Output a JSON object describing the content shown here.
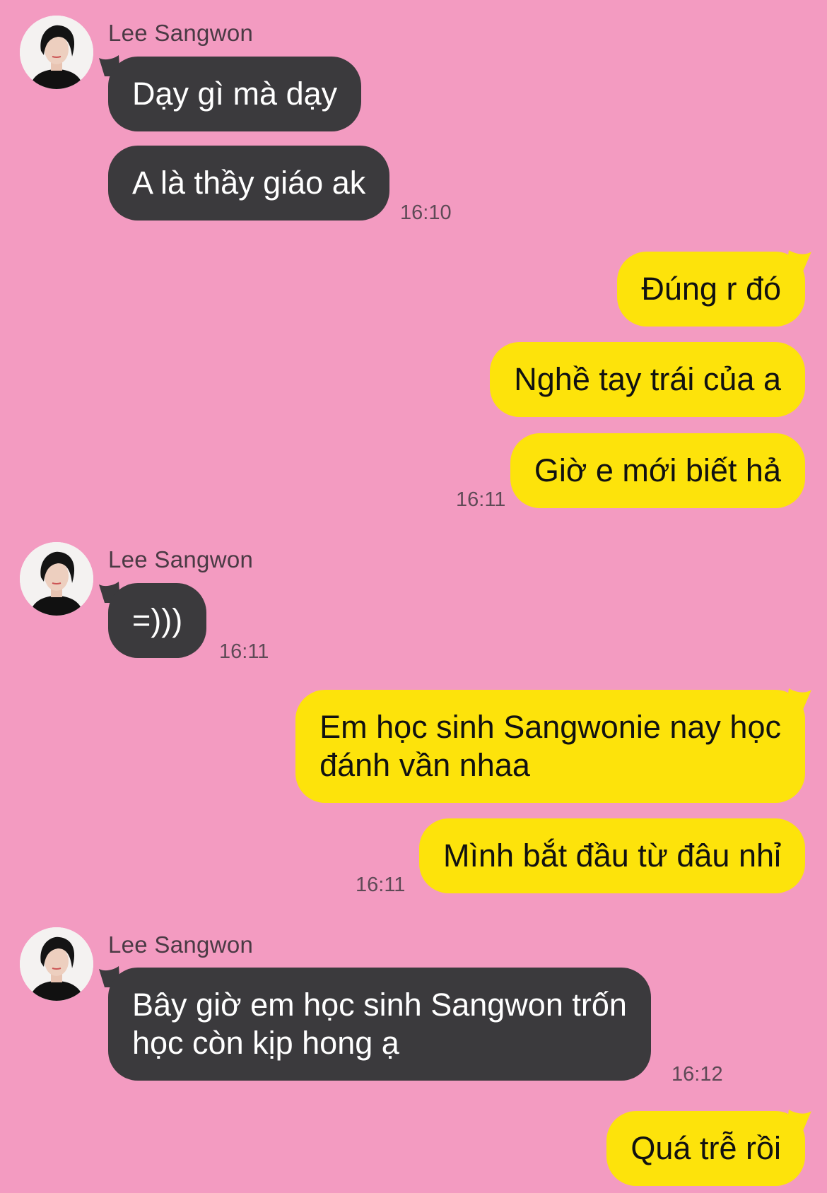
{
  "colors": {
    "background": "#F39BC1",
    "incoming_bubble": "#3b3a3d",
    "outgoing_bubble": "#FDE30B"
  },
  "messages": [
    {
      "sender": "Lee Sangwon",
      "text": "Dạy gì mà dạy"
    },
    {
      "text": "A là thầy giáo ak",
      "time": "16:10"
    },
    {
      "text": "Đúng r đó"
    },
    {
      "text": "Nghề tay trái của a"
    },
    {
      "text": "Giờ e mới biết hả",
      "time": "16:11"
    },
    {
      "sender": "Lee Sangwon",
      "text": "=)))",
      "time": "16:11"
    },
    {
      "text": "Em học sinh Sangwonie nay học\nđánh vần nhaa"
    },
    {
      "text": "Mình bắt đầu từ đâu nhỉ",
      "time": "16:11"
    },
    {
      "sender": "Lee Sangwon",
      "text": "Bây giờ em học sinh Sangwon trốn\nhọc còn kịp hong ạ",
      "time": "16:12"
    },
    {
      "text": "Quá trễ rồi"
    }
  ],
  "avatar_icon": "profile-photo-icon"
}
